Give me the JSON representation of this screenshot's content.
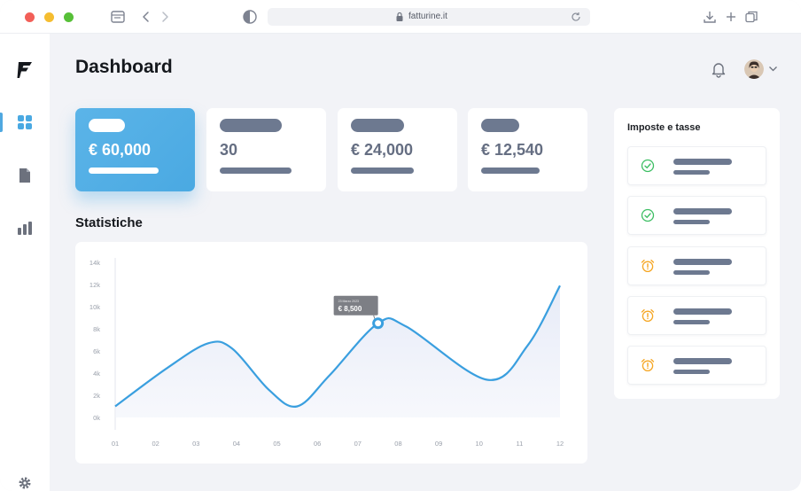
{
  "browser": {
    "url": "fatturine.it"
  },
  "page": {
    "title": "Dashboard"
  },
  "colors": {
    "accent": "#4AA9E2",
    "placeholder": "#6D7990",
    "ok": "#3DBE63",
    "warning": "#F5A623"
  },
  "sidebar": {
    "items": [
      {
        "icon": "dashboard-grid-icon",
        "active": true
      },
      {
        "icon": "document-icon",
        "active": false
      },
      {
        "icon": "bar-chart-icon",
        "active": false
      }
    ],
    "footer_icon": "gear-icon"
  },
  "header": {
    "notification_icon": "bell-icon",
    "avatar_icon": "user-avatar",
    "menu_icon": "chevron-down-icon"
  },
  "stats": [
    {
      "value": "€ 60,000",
      "highlight": true
    },
    {
      "value": "30",
      "highlight": false
    },
    {
      "value": "€ 24,000",
      "highlight": false
    },
    {
      "value": "€ 12,540",
      "highlight": false
    }
  ],
  "statistics": {
    "title": "Statistiche",
    "tooltip": {
      "date": "23 Marzo 2023",
      "value": "€ 8,500"
    }
  },
  "chart_data": {
    "type": "area",
    "title": "Statistiche",
    "xlabel": "",
    "ylabel": "",
    "categories": [
      "01",
      "02",
      "03",
      "04",
      "05",
      "06",
      "07",
      "08",
      "09",
      "10",
      "11",
      "12"
    ],
    "y_ticks": [
      "0k",
      "2k",
      "4k",
      "6k",
      "8k",
      "10k",
      "12k",
      "14k"
    ],
    "ylim": [
      0,
      14000
    ],
    "series": [
      {
        "values": [
          [
            1,
            1000
          ],
          [
            2.3,
            4500
          ],
          [
            3.3,
            6700
          ],
          [
            3.9,
            6200
          ],
          [
            4.8,
            2500
          ],
          [
            5.5,
            1000
          ],
          [
            6.3,
            3800
          ],
          [
            7.5,
            8500
          ],
          [
            8.2,
            8200
          ],
          [
            10.2,
            3400
          ],
          [
            11.2,
            6500
          ],
          [
            12,
            11900
          ]
        ]
      }
    ],
    "highlight_point": {
      "x": 7.5,
      "y": 8500
    },
    "grid": false,
    "fill": true
  },
  "taxes": {
    "title": "Imposte e tasse",
    "items": [
      {
        "status": "ok",
        "icon": "check-circle-icon"
      },
      {
        "status": "ok",
        "icon": "check-circle-icon"
      },
      {
        "status": "warning",
        "icon": "alarm-clock-icon"
      },
      {
        "status": "warning",
        "icon": "alarm-clock-icon"
      },
      {
        "status": "warning",
        "icon": "alarm-clock-icon"
      }
    ]
  }
}
